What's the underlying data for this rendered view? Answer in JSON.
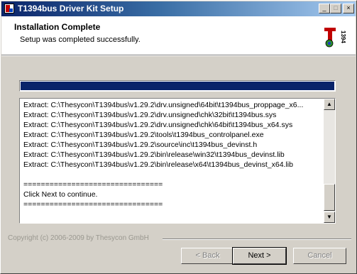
{
  "window": {
    "title": "T1394bus Driver Kit Setup",
    "controls": {
      "minimize": "_",
      "maximize": "□",
      "close": "×"
    }
  },
  "header": {
    "title": "Installation Complete",
    "subtitle": "Setup was completed successfully.",
    "logo": {
      "text": "1394",
      "icon": "thesycon-t1394-logo"
    }
  },
  "progress": {
    "value": 1.0
  },
  "log": {
    "lines": [
      "Extract: C:\\Thesycon\\T1394bus\\v1.29.2\\drv.unsigned\\64bit\\t1394bus_proppage_x6...",
      "Extract: C:\\Thesycon\\T1394bus\\v1.29.2\\drv.unsigned\\chk\\32bit\\t1394bus.sys",
      "Extract: C:\\Thesycon\\T1394bus\\v1.29.2\\drv.unsigned\\chk\\64bit\\t1394bus_x64.sys",
      "Extract: C:\\Thesycon\\T1394bus\\v1.29.2\\tools\\t1394bus_controlpanel.exe",
      "Extract: C:\\Thesycon\\T1394bus\\v1.29.2\\source\\inc\\t1394bus_devinst.h",
      "Extract: C:\\Thesycon\\T1394bus\\v1.29.2\\bin\\release\\win32\\t1394bus_devinst.lib",
      "Extract: C:\\Thesycon\\T1394bus\\v1.29.2\\bin\\release\\x64\\t1394bus_devinst_x64.lib",
      "",
      "================================",
      "Click Next to continue.",
      "================================"
    ]
  },
  "footer": {
    "copyright": "Copyright (c) 2006-2009 by Thesycon GmbH"
  },
  "buttons": {
    "back": "< Back",
    "next": "Next >",
    "cancel": "Cancel"
  },
  "colors": {
    "titlebar_start": "#0a246a",
    "titlebar_end": "#a6caf0",
    "progress_fill": "#0a246a",
    "face": "#d4d0c8"
  }
}
